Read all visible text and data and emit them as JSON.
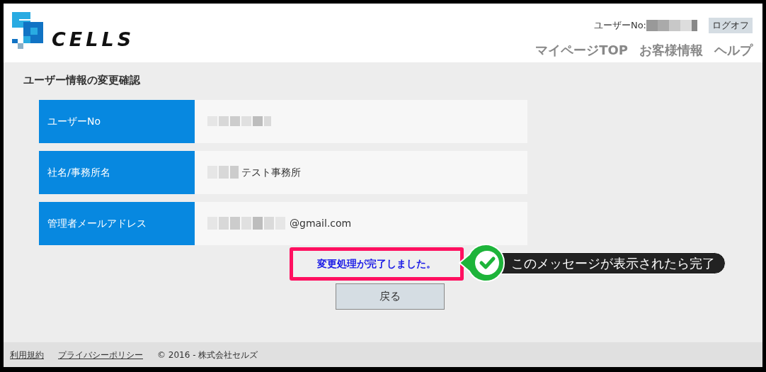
{
  "header": {
    "logo_text": "CELLS",
    "user_label": "ユーザーNo:",
    "logoff_button": "ログオフ",
    "nav": [
      "マイページTOP",
      "お客様情報",
      "ヘルプ"
    ]
  },
  "page_title": "ユーザー情報の変更確認",
  "fields": [
    {
      "label": "ユーザーNo"
    },
    {
      "label": "社名/事務所名",
      "value": "テスト事務所"
    },
    {
      "label": "管理者メールアドレス",
      "value": "@gmail.com"
    }
  ],
  "message": "変更処理が完了しました。",
  "back_button": "戻る",
  "callout": {
    "text": "このメッセージが表示されたら完了"
  },
  "footer": {
    "links": [
      "利用規約",
      "プライバシーポリシー"
    ],
    "copyright": "© 2016 - 株式会社セルズ"
  }
}
